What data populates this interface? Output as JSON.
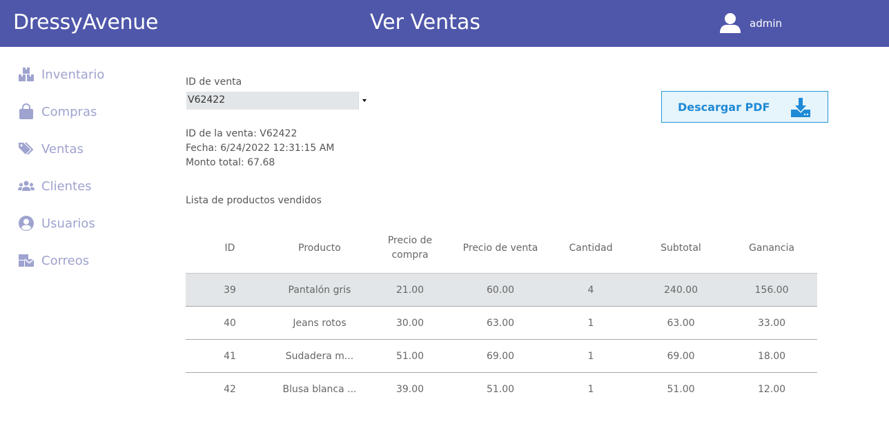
{
  "header": {
    "brand": "DressyAvenue",
    "title": "Ver Ventas",
    "user": "admin",
    "background": "#4f57aa"
  },
  "sidebar": {
    "items": [
      {
        "label": "Inventario",
        "icon": "boxes-icon"
      },
      {
        "label": "Compras",
        "icon": "shopping-bag-icon"
      },
      {
        "label": "Ventas",
        "icon": "tags-icon"
      },
      {
        "label": "Clientes",
        "icon": "users-icon"
      },
      {
        "label": "Usuarios",
        "icon": "user-circle-icon"
      },
      {
        "label": "Correos",
        "icon": "mail-bulk-icon"
      }
    ],
    "color": "#9fa3cf"
  },
  "sale": {
    "select_label": "ID de venta",
    "selected_id": "V62422",
    "id_line": "ID de la venta: V62422",
    "date_line": "Fecha: 6/24/2022 12:31:15 AM",
    "total_line": "Monto total: 67.68",
    "list_title": "Lista de productos vendidos"
  },
  "pdf_button": {
    "label": "Descargar PDF",
    "icon": "download-icon",
    "color": "#1f8ad6"
  },
  "table": {
    "headers": [
      "ID",
      "Producto",
      "Precio de compra",
      "Precio de venta",
      "Cantidad",
      "Subtotal",
      "Ganancia"
    ],
    "rows": [
      [
        "39",
        "Pantalón gris",
        "21.00",
        "60.00",
        "4",
        "240.00",
        "156.00"
      ],
      [
        "40",
        "Jeans rotos",
        "30.00",
        "63.00",
        "1",
        "63.00",
        "33.00"
      ],
      [
        "41",
        "Sudadera m...",
        "51.00",
        "69.00",
        "1",
        "69.00",
        "18.00"
      ],
      [
        "42",
        "Blusa blanca ...",
        "39.00",
        "51.00",
        "1",
        "51.00",
        "12.00"
      ]
    ],
    "selected_row": 0
  }
}
